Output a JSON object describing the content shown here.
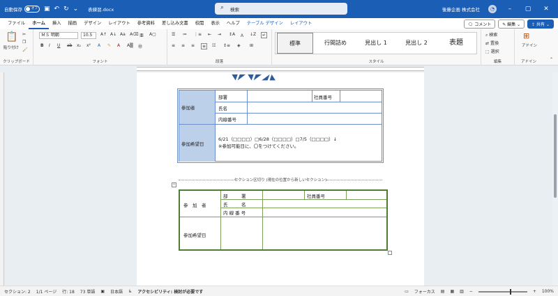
{
  "titlebar": {
    "autosave_label": "自動保存",
    "autosave_state": "オフ",
    "document_name": "表練習.docx",
    "search_placeholder": "検索",
    "user_name": "後藤企画 株式会社"
  },
  "menu": {
    "tabs": [
      "ファイル",
      "ホーム",
      "挿入",
      "描画",
      "デザイン",
      "レイアウト",
      "参考資料",
      "差し込み文書",
      "校閲",
      "表示",
      "ヘルプ",
      "テーブル デザイン",
      "レイアウト"
    ],
    "active_index": 1,
    "contextual_from": 11,
    "comment_label": "コメント",
    "edit_label": "編集",
    "share_label": "共有"
  },
  "ribbon": {
    "clipboard": {
      "paste_label": "貼り付け",
      "group_label": "クリップボード"
    },
    "font": {
      "font_name": "ＭＳ 明朝",
      "font_size": "10.5",
      "group_label": "フォント"
    },
    "paragraph": {
      "group_label": "段落"
    },
    "styles": {
      "items": [
        "標準",
        "行間詰め",
        "見出し 1",
        "見出し 2",
        "表題"
      ],
      "group_label": "スタイル"
    },
    "editing": {
      "find_label": "検索",
      "replace_label": "置換",
      "select_label": "選択",
      "group_label": "編集"
    },
    "addins": {
      "label": "アドイン",
      "group_label": "アドイン"
    }
  },
  "table1": {
    "participant_label": "参加者",
    "dept_label": "部署",
    "employee_no_label": "社員番号",
    "name_label": "氏名",
    "ext_label": "内線番号",
    "dates_label": "参加希望日",
    "dates_text": "6/21（□□□□）□6/28（□□□□）□7/5（□□□□）↓",
    "dates_note": "※参加可能日に、〇をつけてください。"
  },
  "section_break": "セクション区切り (現在の位置から新しいセクション)",
  "table2": {
    "participant_label": "参　加　者",
    "dept_label": "部　　　署",
    "employee_no_label": "社員番号",
    "name_label": "氏　　　名",
    "ext_label": "内 線 番 号",
    "dates_label": "参加希望日"
  },
  "status": {
    "section": "セクション: 2",
    "page": "1/1 ページ",
    "line": "行: 18",
    "words": "73 単語",
    "language": "日本語",
    "accessibility": "アクセシビリティ: 検討が必要です",
    "focus": "フォーカス",
    "zoom": "100%"
  }
}
